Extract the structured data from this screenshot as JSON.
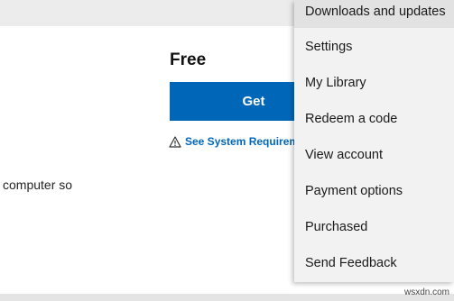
{
  "product": {
    "price": "Free",
    "get_label": "Get",
    "sysreq_label": "See System Requirem",
    "description_fragment": "computer so"
  },
  "menu": {
    "items": [
      {
        "label": "Downloads and updates"
      },
      {
        "label": "Settings"
      },
      {
        "label": "My Library"
      },
      {
        "label": "Redeem a code"
      },
      {
        "label": "View account"
      },
      {
        "label": "Payment options"
      },
      {
        "label": "Purchased"
      },
      {
        "label": "Send Feedback"
      }
    ]
  },
  "icons": {
    "warning": "warning-icon"
  },
  "colors": {
    "accent": "#0067b8",
    "menu_background": "#f2f2f2",
    "menu_highlight": "#e2e2e2"
  },
  "watermark": "wsxdn.com"
}
